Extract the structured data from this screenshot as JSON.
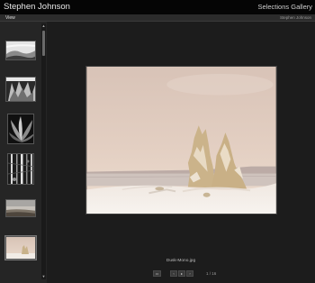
{
  "header": {
    "site_title": "Stephen Johnson",
    "gallery_title": "Selections Gallery"
  },
  "subbar": {
    "view_label": "View",
    "photographer": "Stephen Johnson"
  },
  "sidebar": {
    "thumbnails": [
      {
        "subject": "bw-landscape-mist",
        "selected": false
      },
      {
        "subject": "bw-rock-formation",
        "selected": false
      },
      {
        "subject": "bw-agave-plant",
        "selected": false
      },
      {
        "subject": "bw-forest-trees",
        "selected": false
      },
      {
        "subject": "color-shoreline",
        "selected": false
      },
      {
        "subject": "color-tufa-snow",
        "selected": true
      }
    ],
    "scroll_up_icon": "triangle-up-icon",
    "scroll_down_icon": "triangle-down-icon"
  },
  "viewer": {
    "caption": "Dusk-Mono.jpg",
    "counter": "1 / 16",
    "controls": {
      "fullscreen_icon": "fullscreen-icon",
      "prev_icon": "chevron-left-icon",
      "play_icon": "play-icon",
      "next_icon": "chevron-right-icon"
    }
  },
  "colors": {
    "header_bg": "#050505",
    "sidebar_bg": "#252525",
    "main_bg": "#1c1c1c",
    "sky_top": "#d9c4b6",
    "sky_bottom": "#e9d6c7",
    "snow": "#f3eee8",
    "tufa": "#cdb78f"
  }
}
